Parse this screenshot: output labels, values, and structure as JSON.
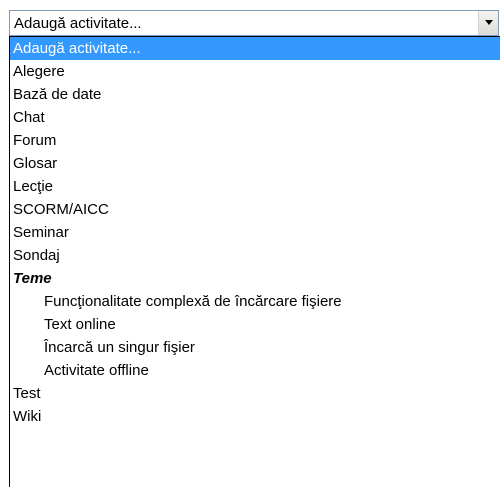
{
  "select": {
    "value": "Adaugă activitate..."
  },
  "options": [
    {
      "label": "Adaugă activitate...",
      "selected": true
    },
    {
      "label": "Alegere"
    },
    {
      "label": "Bază de date"
    },
    {
      "label": "Chat"
    },
    {
      "label": "Forum"
    },
    {
      "label": "Glosar"
    },
    {
      "label": "Lecţie"
    },
    {
      "label": "SCORM/AICC"
    },
    {
      "label": "Seminar"
    },
    {
      "label": "Sondaj"
    },
    {
      "label": "Teme",
      "group": true
    },
    {
      "label": "Funcţionalitate complexă de încărcare fişiere",
      "indent": true
    },
    {
      "label": "Text online",
      "indent": true
    },
    {
      "label": "Încarcă un singur fişier",
      "indent": true
    },
    {
      "label": "Activitate offline",
      "indent": true
    },
    {
      "label": "Test"
    },
    {
      "label": "Wiki"
    }
  ]
}
